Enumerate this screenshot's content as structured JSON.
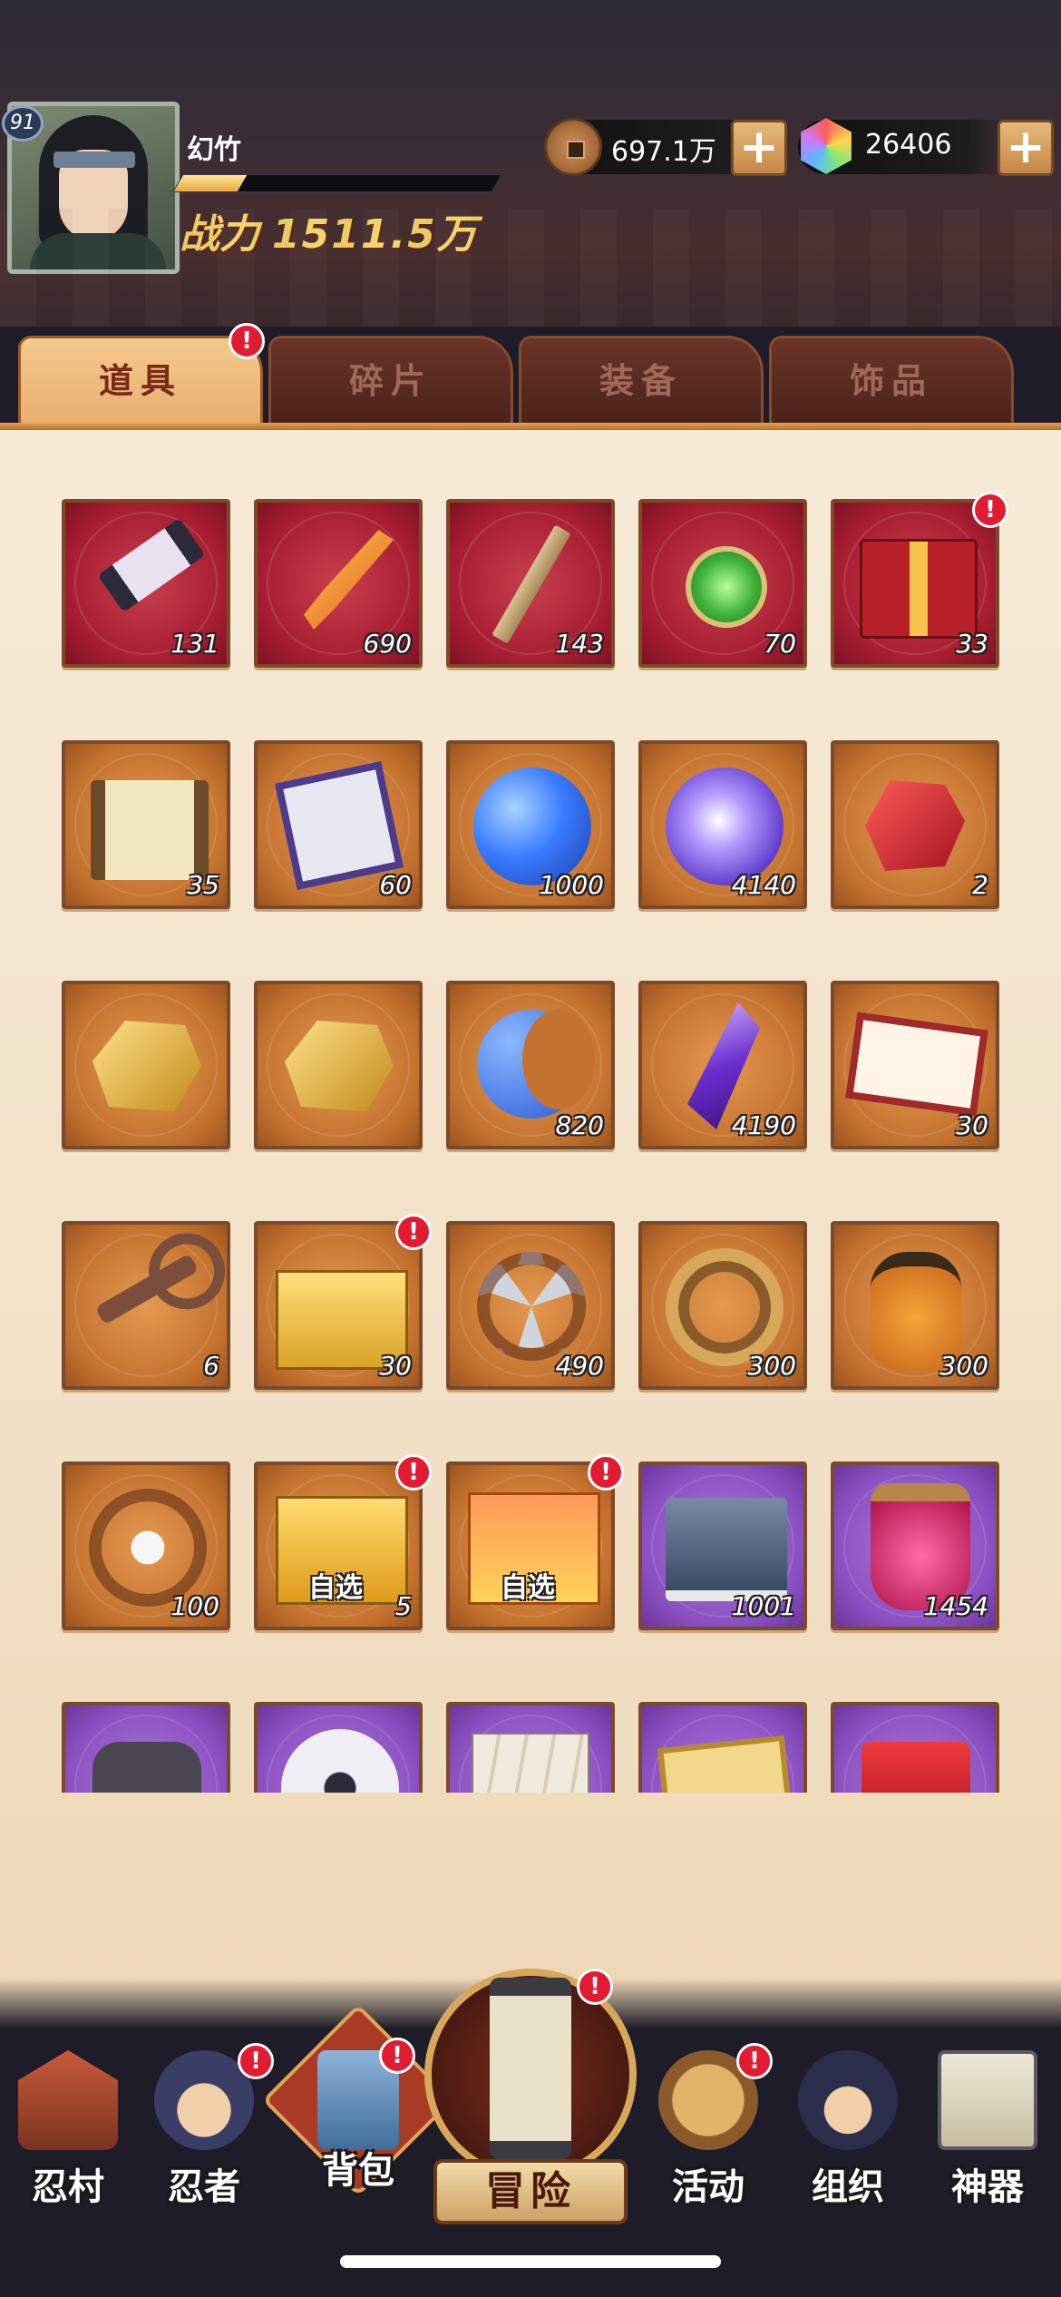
{
  "player": {
    "level": "91",
    "name": "幻竹",
    "exp_fraction": 0.2,
    "power_label": "战力",
    "power_value": "1511.5万"
  },
  "currencies": {
    "copper": {
      "value": "697.1万",
      "icon": "copper-coin-icon"
    },
    "gem": {
      "value": "26406",
      "icon": "rainbow-gem-icon"
    },
    "plus_label": "+"
  },
  "tabs": [
    {
      "label": "道具",
      "active": true,
      "alert": true
    },
    {
      "label": "碎片",
      "active": false,
      "alert": false
    },
    {
      "label": "装备",
      "active": false,
      "alert": false
    },
    {
      "label": "饰品",
      "active": false,
      "alert": false
    }
  ],
  "alert_mark": "!",
  "items": [
    {
      "icon": "scroll-icon",
      "rarity": "red",
      "count": "131"
    },
    {
      "icon": "flame-feather-icon",
      "rarity": "red",
      "count": "690"
    },
    {
      "icon": "wooden-stick-icon",
      "rarity": "red",
      "count": "143"
    },
    {
      "icon": "jade-medal-icon",
      "rarity": "red",
      "count": "70"
    },
    {
      "icon": "gift-box-icon",
      "rarity": "red",
      "count": "33",
      "alert": true
    },
    {
      "icon": "parchment-scroll-icon",
      "rarity": "orange",
      "count": "35"
    },
    {
      "icon": "awaken-banner-icon",
      "rarity": "orange",
      "count": "60"
    },
    {
      "icon": "blue-orb-icon",
      "rarity": "orange",
      "count": "1000"
    },
    {
      "icon": "purple-orb-icon",
      "rarity": "orange",
      "count": "4140"
    },
    {
      "icon": "red-stone-icon",
      "rarity": "orange",
      "count": "2"
    },
    {
      "icon": "lightning-stone-icon",
      "rarity": "orange",
      "count": ""
    },
    {
      "icon": "wind-stone-icon",
      "rarity": "orange",
      "count": ""
    },
    {
      "icon": "blue-moon-icon",
      "rarity": "orange",
      "count": "820"
    },
    {
      "icon": "purple-crystal-icon",
      "rarity": "orange",
      "count": "4190"
    },
    {
      "icon": "lucky-ticket-icon",
      "rarity": "orange",
      "count": "30"
    },
    {
      "icon": "bronze-key-icon",
      "rarity": "orange",
      "count": "6"
    },
    {
      "icon": "gold-box-icon",
      "rarity": "orange",
      "count": "30",
      "alert": true
    },
    {
      "icon": "shuriken-blade-icon",
      "rarity": "orange",
      "count": "490"
    },
    {
      "icon": "rope-coil-icon",
      "rarity": "orange",
      "count": "300"
    },
    {
      "icon": "sake-jar-icon",
      "rarity": "orange",
      "count": "300"
    },
    {
      "icon": "bow-ornament-icon",
      "rarity": "orange",
      "count": "100"
    },
    {
      "icon": "selectable-box-icon",
      "rarity": "orange",
      "count": "5",
      "tag": "自选",
      "alert": true
    },
    {
      "icon": "selectable-chest-icon",
      "rarity": "orange",
      "count": "",
      "tag": "自选",
      "alert": true
    },
    {
      "icon": "blue-book-icon",
      "rarity": "purple",
      "count": "1001"
    },
    {
      "icon": "pink-bottle-icon",
      "rarity": "purple",
      "count": "1454"
    },
    {
      "icon": "dark-stone-icon",
      "rarity": "purple",
      "count": ""
    },
    {
      "icon": "eye-orb-icon",
      "rarity": "purple",
      "count": ""
    },
    {
      "icon": "card-stack-icon",
      "rarity": "purple",
      "count": ""
    },
    {
      "icon": "yellow-ticket-icon",
      "rarity": "purple",
      "count": ""
    },
    {
      "icon": "red-bag-icon",
      "rarity": "purple",
      "count": ""
    }
  ],
  "nav": [
    {
      "label": "忍村",
      "icon": "village-gate-icon",
      "alert": false
    },
    {
      "label": "忍者",
      "icon": "ninja-head-icon",
      "alert": true
    },
    {
      "label": "背包",
      "icon": "backpack-icon",
      "alert": true
    },
    {
      "label": "冒险",
      "icon": "adventure-scroll-icon",
      "alert": true
    },
    {
      "label": "活动",
      "icon": "activity-drum-icon",
      "alert": true
    },
    {
      "label": "组织",
      "icon": "organization-icon",
      "alert": false
    },
    {
      "label": "神器",
      "icon": "artifact-scroll-icon",
      "alert": false
    }
  ]
}
